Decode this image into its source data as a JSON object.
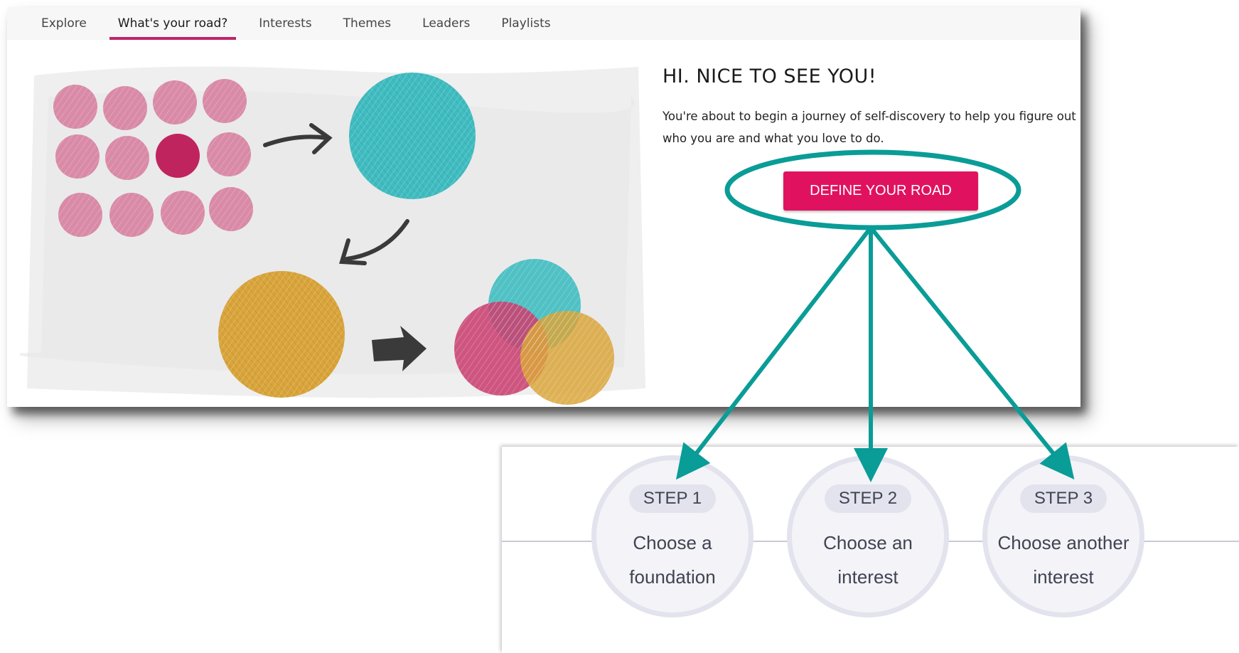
{
  "nav": {
    "tabs": [
      {
        "label": "Explore"
      },
      {
        "label": "What's your road?"
      },
      {
        "label": "Interests"
      },
      {
        "label": "Themes"
      },
      {
        "label": "Leaders"
      },
      {
        "label": "Playlists"
      }
    ],
    "active_tab": "What's your road?"
  },
  "welcome": {
    "title": "HI. NICE TO SEE YOU!",
    "text": "You're about to begin a journey of self-discovery to help you figure out who you are and what you love to do.",
    "button_label": "DEFINE YOUR ROAD"
  },
  "steps": [
    {
      "badge": "STEP 1",
      "line1": "Choose a",
      "line2": "foundation"
    },
    {
      "badge": "STEP 2",
      "line1": "Choose an",
      "line2": "interest"
    },
    {
      "badge": "STEP 3",
      "line1": "Choose another",
      "line2": "interest"
    }
  ],
  "colors": {
    "accent": "#e0125f",
    "tab_underline": "#c0246a",
    "annotation": "#0a9c97",
    "dot_pink": "#d98aa6",
    "dot_selected": "#c0245f",
    "teal": "#3fbcc0",
    "mustard": "#d9a43a",
    "magenta": "#c9406f"
  },
  "icons": {
    "arrows": "hand-drawn-arrow-icon"
  }
}
